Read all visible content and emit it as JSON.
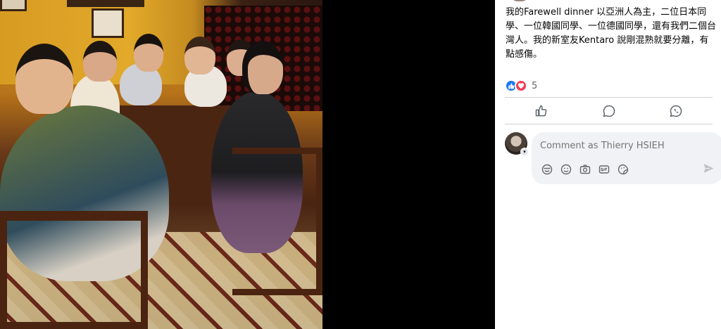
{
  "post": {
    "text": "我的Farewell dinner 以亞洲人為主，二位日本同學、一位韓國同學、一位德國同學，還有我們二個台灣人。我的新室友Kentaro 說剛混熟就要分離，有點感傷。",
    "reaction_count": "5",
    "reactions": [
      "like-icon",
      "love-icon"
    ]
  },
  "actions": [
    "like-icon",
    "comment-icon",
    "whatsapp-share-icon"
  ],
  "composer": {
    "placeholder": "Comment as Thierry HSIEH",
    "tools": [
      "avatar-sticker-icon",
      "emoji-icon",
      "camera-icon",
      "gif-icon",
      "sticker-icon"
    ],
    "send": "send-icon"
  },
  "colors": {
    "accent": "#1877f2",
    "love": "#f33e58",
    "text": "#050505",
    "secondary_text": "#65676b",
    "comment_bg": "#f0f2f5"
  }
}
